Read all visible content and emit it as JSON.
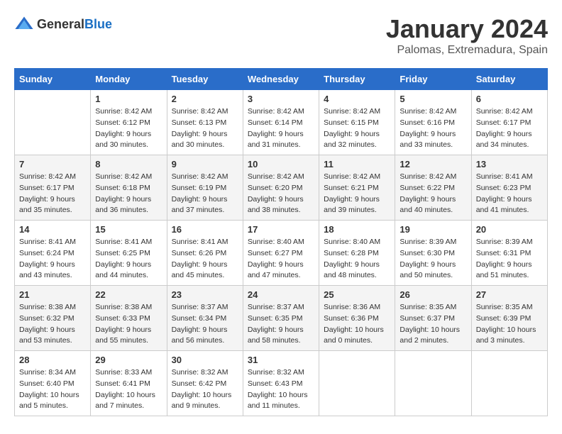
{
  "header": {
    "logo_general": "General",
    "logo_blue": "Blue",
    "month_title": "January 2024",
    "location": "Palomas, Extremadura, Spain"
  },
  "days_of_week": [
    "Sunday",
    "Monday",
    "Tuesday",
    "Wednesday",
    "Thursday",
    "Friday",
    "Saturday"
  ],
  "weeks": [
    [
      {
        "day": "",
        "sunrise": "",
        "sunset": "",
        "daylight": ""
      },
      {
        "day": "1",
        "sunrise": "Sunrise: 8:42 AM",
        "sunset": "Sunset: 6:12 PM",
        "daylight": "Daylight: 9 hours and 30 minutes."
      },
      {
        "day": "2",
        "sunrise": "Sunrise: 8:42 AM",
        "sunset": "Sunset: 6:13 PM",
        "daylight": "Daylight: 9 hours and 30 minutes."
      },
      {
        "day": "3",
        "sunrise": "Sunrise: 8:42 AM",
        "sunset": "Sunset: 6:14 PM",
        "daylight": "Daylight: 9 hours and 31 minutes."
      },
      {
        "day": "4",
        "sunrise": "Sunrise: 8:42 AM",
        "sunset": "Sunset: 6:15 PM",
        "daylight": "Daylight: 9 hours and 32 minutes."
      },
      {
        "day": "5",
        "sunrise": "Sunrise: 8:42 AM",
        "sunset": "Sunset: 6:16 PM",
        "daylight": "Daylight: 9 hours and 33 minutes."
      },
      {
        "day": "6",
        "sunrise": "Sunrise: 8:42 AM",
        "sunset": "Sunset: 6:17 PM",
        "daylight": "Daylight: 9 hours and 34 minutes."
      }
    ],
    [
      {
        "day": "7",
        "sunrise": "Sunrise: 8:42 AM",
        "sunset": "Sunset: 6:17 PM",
        "daylight": "Daylight: 9 hours and 35 minutes."
      },
      {
        "day": "8",
        "sunrise": "Sunrise: 8:42 AM",
        "sunset": "Sunset: 6:18 PM",
        "daylight": "Daylight: 9 hours and 36 minutes."
      },
      {
        "day": "9",
        "sunrise": "Sunrise: 8:42 AM",
        "sunset": "Sunset: 6:19 PM",
        "daylight": "Daylight: 9 hours and 37 minutes."
      },
      {
        "day": "10",
        "sunrise": "Sunrise: 8:42 AM",
        "sunset": "Sunset: 6:20 PM",
        "daylight": "Daylight: 9 hours and 38 minutes."
      },
      {
        "day": "11",
        "sunrise": "Sunrise: 8:42 AM",
        "sunset": "Sunset: 6:21 PM",
        "daylight": "Daylight: 9 hours and 39 minutes."
      },
      {
        "day": "12",
        "sunrise": "Sunrise: 8:42 AM",
        "sunset": "Sunset: 6:22 PM",
        "daylight": "Daylight: 9 hours and 40 minutes."
      },
      {
        "day": "13",
        "sunrise": "Sunrise: 8:41 AM",
        "sunset": "Sunset: 6:23 PM",
        "daylight": "Daylight: 9 hours and 41 minutes."
      }
    ],
    [
      {
        "day": "14",
        "sunrise": "Sunrise: 8:41 AM",
        "sunset": "Sunset: 6:24 PM",
        "daylight": "Daylight: 9 hours and 43 minutes."
      },
      {
        "day": "15",
        "sunrise": "Sunrise: 8:41 AM",
        "sunset": "Sunset: 6:25 PM",
        "daylight": "Daylight: 9 hours and 44 minutes."
      },
      {
        "day": "16",
        "sunrise": "Sunrise: 8:41 AM",
        "sunset": "Sunset: 6:26 PM",
        "daylight": "Daylight: 9 hours and 45 minutes."
      },
      {
        "day": "17",
        "sunrise": "Sunrise: 8:40 AM",
        "sunset": "Sunset: 6:27 PM",
        "daylight": "Daylight: 9 hours and 47 minutes."
      },
      {
        "day": "18",
        "sunrise": "Sunrise: 8:40 AM",
        "sunset": "Sunset: 6:28 PM",
        "daylight": "Daylight: 9 hours and 48 minutes."
      },
      {
        "day": "19",
        "sunrise": "Sunrise: 8:39 AM",
        "sunset": "Sunset: 6:30 PM",
        "daylight": "Daylight: 9 hours and 50 minutes."
      },
      {
        "day": "20",
        "sunrise": "Sunrise: 8:39 AM",
        "sunset": "Sunset: 6:31 PM",
        "daylight": "Daylight: 9 hours and 51 minutes."
      }
    ],
    [
      {
        "day": "21",
        "sunrise": "Sunrise: 8:38 AM",
        "sunset": "Sunset: 6:32 PM",
        "daylight": "Daylight: 9 hours and 53 minutes."
      },
      {
        "day": "22",
        "sunrise": "Sunrise: 8:38 AM",
        "sunset": "Sunset: 6:33 PM",
        "daylight": "Daylight: 9 hours and 55 minutes."
      },
      {
        "day": "23",
        "sunrise": "Sunrise: 8:37 AM",
        "sunset": "Sunset: 6:34 PM",
        "daylight": "Daylight: 9 hours and 56 minutes."
      },
      {
        "day": "24",
        "sunrise": "Sunrise: 8:37 AM",
        "sunset": "Sunset: 6:35 PM",
        "daylight": "Daylight: 9 hours and 58 minutes."
      },
      {
        "day": "25",
        "sunrise": "Sunrise: 8:36 AM",
        "sunset": "Sunset: 6:36 PM",
        "daylight": "Daylight: 10 hours and 0 minutes."
      },
      {
        "day": "26",
        "sunrise": "Sunrise: 8:35 AM",
        "sunset": "Sunset: 6:37 PM",
        "daylight": "Daylight: 10 hours and 2 minutes."
      },
      {
        "day": "27",
        "sunrise": "Sunrise: 8:35 AM",
        "sunset": "Sunset: 6:39 PM",
        "daylight": "Daylight: 10 hours and 3 minutes."
      }
    ],
    [
      {
        "day": "28",
        "sunrise": "Sunrise: 8:34 AM",
        "sunset": "Sunset: 6:40 PM",
        "daylight": "Daylight: 10 hours and 5 minutes."
      },
      {
        "day": "29",
        "sunrise": "Sunrise: 8:33 AM",
        "sunset": "Sunset: 6:41 PM",
        "daylight": "Daylight: 10 hours and 7 minutes."
      },
      {
        "day": "30",
        "sunrise": "Sunrise: 8:32 AM",
        "sunset": "Sunset: 6:42 PM",
        "daylight": "Daylight: 10 hours and 9 minutes."
      },
      {
        "day": "31",
        "sunrise": "Sunrise: 8:32 AM",
        "sunset": "Sunset: 6:43 PM",
        "daylight": "Daylight: 10 hours and 11 minutes."
      },
      {
        "day": "",
        "sunrise": "",
        "sunset": "",
        "daylight": ""
      },
      {
        "day": "",
        "sunrise": "",
        "sunset": "",
        "daylight": ""
      },
      {
        "day": "",
        "sunrise": "",
        "sunset": "",
        "daylight": ""
      }
    ]
  ]
}
